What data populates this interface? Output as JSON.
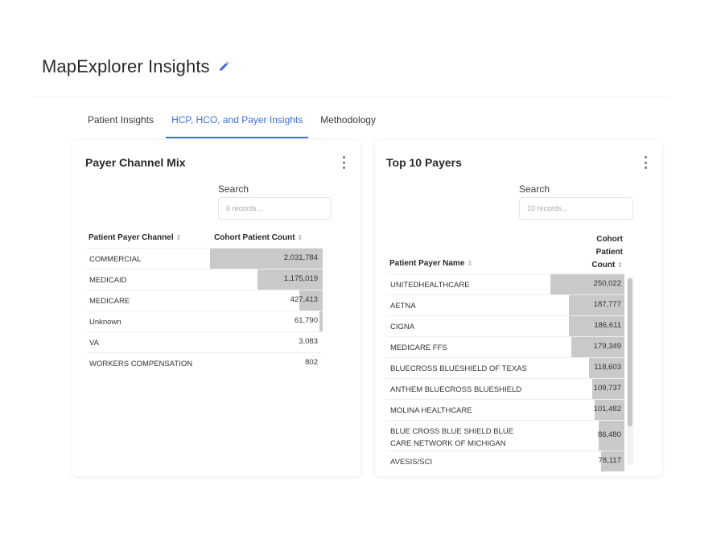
{
  "header": {
    "title": "MapExplorer Insights",
    "edit_icon": "pencil-icon",
    "accent": "#3f6fd8"
  },
  "tabs": [
    {
      "label": "Patient Insights",
      "active": false
    },
    {
      "label": "HCP, HCO, and Payer Insights",
      "active": true
    },
    {
      "label": "Methodology",
      "active": false
    }
  ],
  "payer_channel_mix": {
    "title": "Payer Channel Mix",
    "search_label": "Search",
    "search_placeholder": "6 records...",
    "columns": [
      "Patient Payer Channel",
      "Cohort Patient Count"
    ],
    "max_value": 2031784,
    "rows": [
      {
        "name": "COMMERCIAL",
        "value": 2031784,
        "label": "2,031,784"
      },
      {
        "name": "MEDICAID",
        "value": 1175019,
        "label": "1,175,019"
      },
      {
        "name": "MEDICARE",
        "value": 427413,
        "label": "427,413"
      },
      {
        "name": "Unknown",
        "value": 61790,
        "label": "61,790"
      },
      {
        "name": "VA",
        "value": 3083,
        "label": "3,083"
      },
      {
        "name": "WORKERS COMPENSATION",
        "value": 802,
        "label": "802"
      }
    ]
  },
  "top_payers": {
    "title": "Top 10 Payers",
    "search_label": "Search",
    "search_placeholder": "10 records...",
    "columns": [
      "Patient Payer Name",
      "Cohort Patient Count"
    ],
    "max_value": 250022,
    "rows": [
      {
        "name": "UNITEDHEALTHCARE",
        "value": 250022,
        "label": "250,022"
      },
      {
        "name": "AETNA",
        "value": 187777,
        "label": "187,777"
      },
      {
        "name": "CIGNA",
        "value": 186611,
        "label": "186,611"
      },
      {
        "name": "MEDICARE FFS",
        "value": 179349,
        "label": "179,349"
      },
      {
        "name": "BLUECROSS BLUESHIELD OF TEXAS",
        "value": 118603,
        "label": "118,603"
      },
      {
        "name": "ANTHEM BLUECROSS BLUESHIELD",
        "value": 109737,
        "label": "109,737"
      },
      {
        "name": "MOLINA HEALTHCARE",
        "value": 101482,
        "label": "101,482"
      },
      {
        "name": "BLUE CROSS BLUE SHIELD BLUE CARE NETWORK OF MICHIGAN",
        "value": 86480,
        "label": "86,480"
      },
      {
        "name": "AVESIS/SCI",
        "value": 78117,
        "label": "78,117"
      }
    ]
  },
  "colors": {
    "bar": "#c9c9c9",
    "row_border": "#eceef1"
  }
}
